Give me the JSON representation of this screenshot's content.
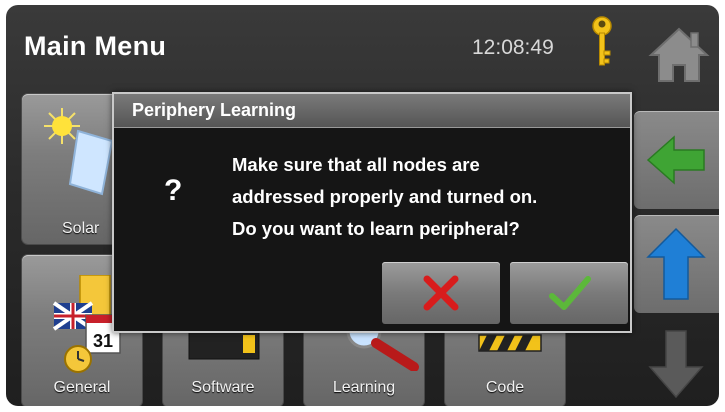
{
  "header": {
    "title": "Main Menu",
    "clock": "12:08:49",
    "key_icon": "key-icon",
    "home_icon": "home-icon"
  },
  "tiles": [
    {
      "label": "Solar",
      "icon": "solar-panel-icon"
    },
    {
      "label": "General",
      "icon": "calendar-flag-clock-icon"
    },
    {
      "label": "Software",
      "icon": "software-device-icon"
    },
    {
      "label": "Learning",
      "icon": "magnifier-icon"
    },
    {
      "label": "Code",
      "icon": "code-barrier-icon"
    }
  ],
  "side_nav": [
    {
      "icon": "arrow-left-icon",
      "color": "#3fa434"
    },
    {
      "icon": "arrow-up-icon",
      "color": "#1f7fd6"
    },
    {
      "icon": "arrow-down-icon",
      "color": "#5a5a5a"
    }
  ],
  "dialog": {
    "title": "Periphery Learning",
    "question_mark": "?",
    "message_lines": [
      "Make sure that all nodes are",
      "addressed properly and turned on.",
      "Do you want to learn peripheral?"
    ],
    "cancel_icon": "cross-icon",
    "confirm_icon": "checkmark-icon",
    "cancel_color": "#d81c1c",
    "confirm_color": "#5cb83a"
  }
}
